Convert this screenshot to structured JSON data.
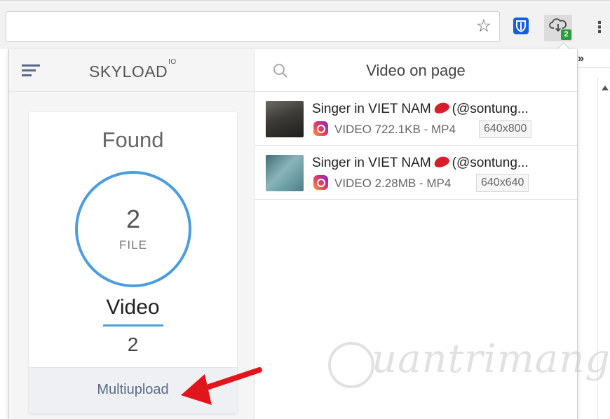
{
  "browser": {
    "star_icon": "star-icon",
    "extension_badge": "2",
    "extensions": [
      "bitwarden-shield-icon",
      "cloud-download-icon"
    ],
    "overflow": "»"
  },
  "popup": {
    "brand": "SKYLOAD",
    "brand_sup": "IO",
    "found_label": "Found",
    "file_count": "2",
    "file_label": "FILE",
    "type_label": "Video",
    "type_count": "2",
    "multiupload_label": "Multiupload",
    "right_title": "Video on page",
    "videos": [
      {
        "title_start": "Singer in VIET NAM",
        "title_end": "(@sontung...",
        "meta": "VIDEO 722.1KB - MP4",
        "resolution": "640x800"
      },
      {
        "title_start": "Singer in VIET NAM",
        "title_end": "(@sontung...",
        "meta": "VIDEO 2.28MB - MP4",
        "resolution": "640x640"
      }
    ]
  },
  "watermark": {
    "text": "uantrimang"
  },
  "colors": {
    "accent_blue": "#4c9de0",
    "badge_green": "#2a9d3a",
    "arrow_red": "#e0161c",
    "multi_text": "#5c6b8a"
  }
}
